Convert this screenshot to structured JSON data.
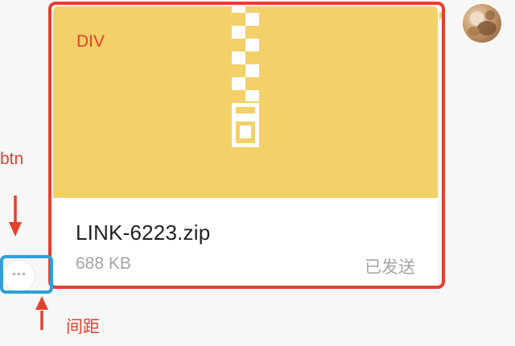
{
  "annotations": {
    "div_label": "DIV",
    "btn_label": "btn",
    "spacing_label": "间距"
  },
  "file_card": {
    "file_name": "LINK-6223.zip",
    "file_size": "688 KB",
    "status": "已发送"
  },
  "more_button": {
    "dots": "•••"
  },
  "colors": {
    "cover": "#f4d068",
    "annotation_red": "#e4412f",
    "annotation_blue": "#2f9fd8",
    "muted_text": "#a4a4a4"
  },
  "icons": {
    "zipper": "zip-zipper-icon",
    "more": "more-dots-icon",
    "avatar": "user-avatar"
  }
}
